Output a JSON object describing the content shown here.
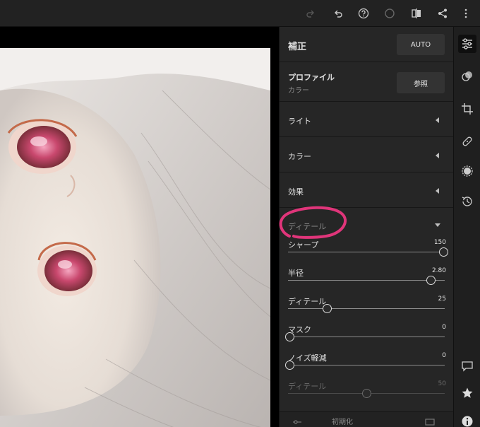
{
  "topbar": {
    "icons": [
      "redo-icon",
      "undo-icon",
      "help-icon",
      "circle-icon",
      "compare-icon",
      "share-icon",
      "more-icon"
    ]
  },
  "panel": {
    "title": "補正",
    "auto_label": "AUTO",
    "profile": {
      "label": "プロファイル",
      "value": "カラー",
      "browse_label": "参照"
    },
    "sections": [
      {
        "label": "ライト"
      },
      {
        "label": "カラー"
      },
      {
        "label": "効果"
      }
    ],
    "detail": {
      "label": "ディテール",
      "sliders": [
        {
          "label": "シャープ",
          "value": "150",
          "fraction": 1.0
        },
        {
          "label": "半径",
          "value": "2.80",
          "fraction": 0.91
        },
        {
          "label": "ディテール",
          "value": "25",
          "fraction": 0.25
        },
        {
          "label": "マスク",
          "value": "0",
          "fraction": 0.0
        },
        {
          "label": "ノイズ軽減",
          "value": "0",
          "fraction": 0.0
        },
        {
          "label": "ディテール",
          "value": "50",
          "fraction": 0.5,
          "disabled": true
        }
      ]
    },
    "bottom": {
      "reset_label": "初期化"
    }
  },
  "toolstrip": {
    "icons": [
      "edit-sliders-icon",
      "mixer-icon",
      "crop-icon",
      "healing-icon",
      "mask-icon",
      "history-icon",
      "comment-icon",
      "star-icon",
      "info-icon"
    ]
  },
  "colors": {
    "accent_annotation": "#e0357a",
    "panel_bg": "#262626"
  }
}
